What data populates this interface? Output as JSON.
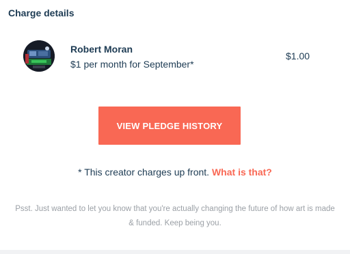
{
  "section": {
    "title": "Charge details"
  },
  "charge": {
    "avatar_icon": "creator-avatar-image",
    "creator_name": "Robert Moran",
    "description": "$1 per month for September*",
    "amount": "$1.00"
  },
  "actions": {
    "view_pledge_history_label": "VIEW PLEDGE HISTORY"
  },
  "note": {
    "text": "* This creator charges up front.",
    "link_label": "What is that?"
  },
  "footer": {
    "message": "Psst. Just wanted to let you know that you're actually changing the future of how art is made & funded. Keep being you."
  },
  "colors": {
    "accent": "#f96854",
    "text_primary": "#1d3b53",
    "text_muted": "#9ba0a6",
    "background": "#ffffff"
  }
}
